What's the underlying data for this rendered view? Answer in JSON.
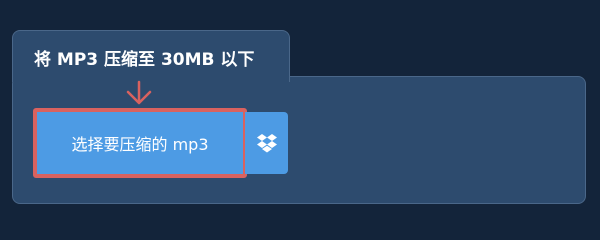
{
  "panel": {
    "title": "将 MP3 压缩至 30MB 以下"
  },
  "upload": {
    "label": "选择要压缩的 mp3",
    "icon": "arrow-down-icon"
  },
  "dropbox": {
    "icon": "dropbox-icon"
  },
  "colors": {
    "background": "#13243a",
    "panel": "#2d4b6e",
    "button": "#4d9be4",
    "highlight": "#d9625f"
  }
}
